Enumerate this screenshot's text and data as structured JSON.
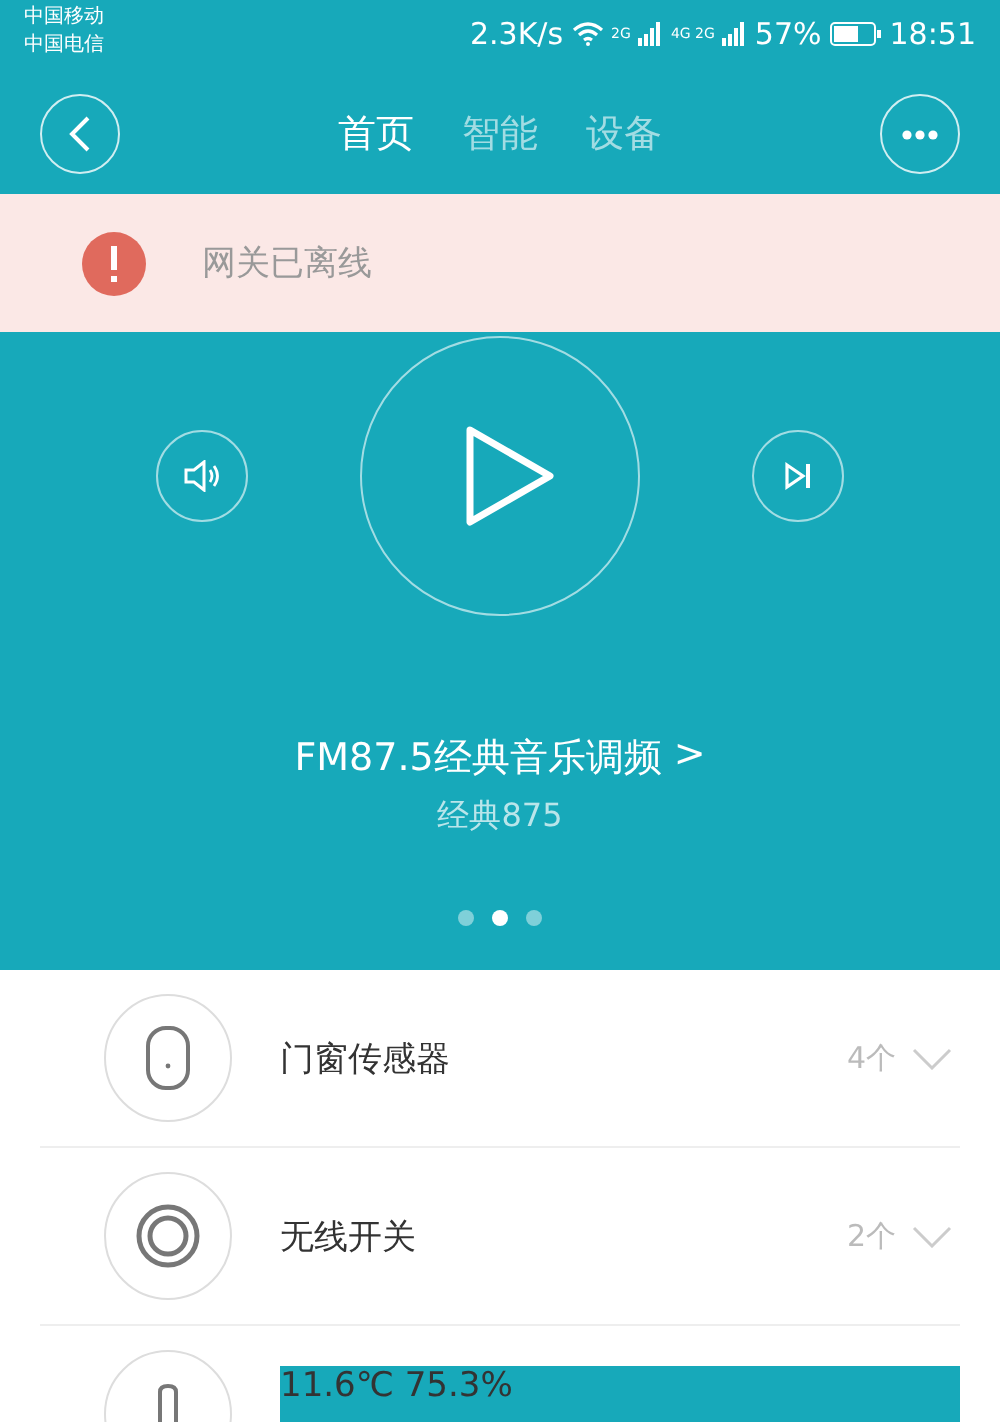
{
  "status_bar": {
    "carriers": [
      "中国移动",
      "中国电信"
    ],
    "speed": "2.3K/s",
    "sim1_label": "2G",
    "sim2_label": "4G 2G",
    "battery": "57%",
    "time": "18:51"
  },
  "tabs": [
    {
      "label": "首页",
      "selected": true
    },
    {
      "label": "智能",
      "selected": false
    },
    {
      "label": "设备",
      "selected": false
    }
  ],
  "alert": {
    "message": "网关已离线"
  },
  "player": {
    "station": "FM87.5经典音乐调频",
    "chevron": ">",
    "subtitle": "经典875"
  },
  "pager": [
    {
      "selected": false
    },
    {
      "selected": true
    },
    {
      "selected": false
    }
  ],
  "devices": [
    {
      "kind": "door",
      "name": "门窗传感器",
      "count": "4个"
    },
    {
      "kind": "switch",
      "name": "无线开关",
      "count": "2个"
    },
    {
      "kind": "thermo",
      "name": "11.6℃   75.3%"
    }
  ]
}
